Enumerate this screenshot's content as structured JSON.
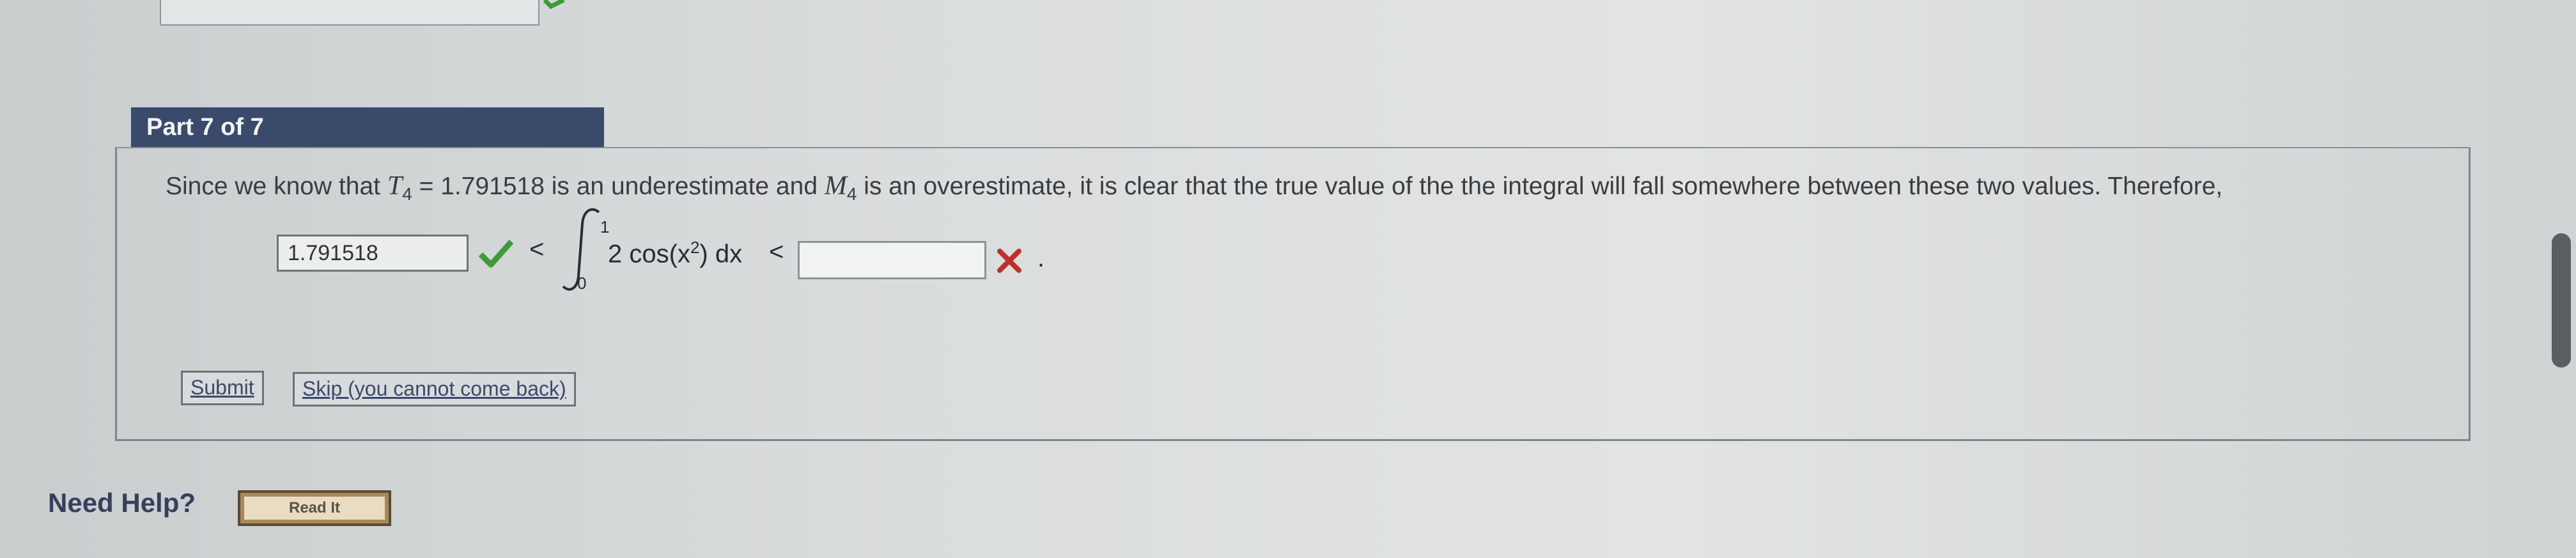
{
  "part": {
    "header": "Part 7 of 7"
  },
  "statement": {
    "p1": "Since we know that ",
    "T_sym": "T",
    "T_sub": "4",
    "p2": " = 1.791518 is an underestimate and ",
    "M_sym": "M",
    "M_sub": "4",
    "p3": " is an overestimate, it is clear that the true value of the the integral will fall somewhere between these two values. Therefore,"
  },
  "inequality": {
    "answer1_value": "1.791518",
    "answer1_status": "correct",
    "lt1": "<",
    "upper_limit": "1",
    "lower_limit": "0",
    "integrand_pre": "2 cos(x",
    "integrand_exp": "2",
    "integrand_post": ") dx",
    "lt2": "<",
    "answer2_value": "",
    "answer2_status": "incorrect",
    "period": "."
  },
  "buttons": {
    "submit": "Submit",
    "skip": "Skip (you cannot come back)"
  },
  "help": {
    "label": "Need Help?",
    "read_it": "Read It"
  },
  "colors": {
    "header_bg": "#3a4a6b",
    "check_green": "#3f9a3a",
    "error_red": "#c0302a",
    "read_it_bg": "#e9dcc3"
  },
  "icons": {
    "correct": "check-icon",
    "incorrect": "x-icon"
  }
}
